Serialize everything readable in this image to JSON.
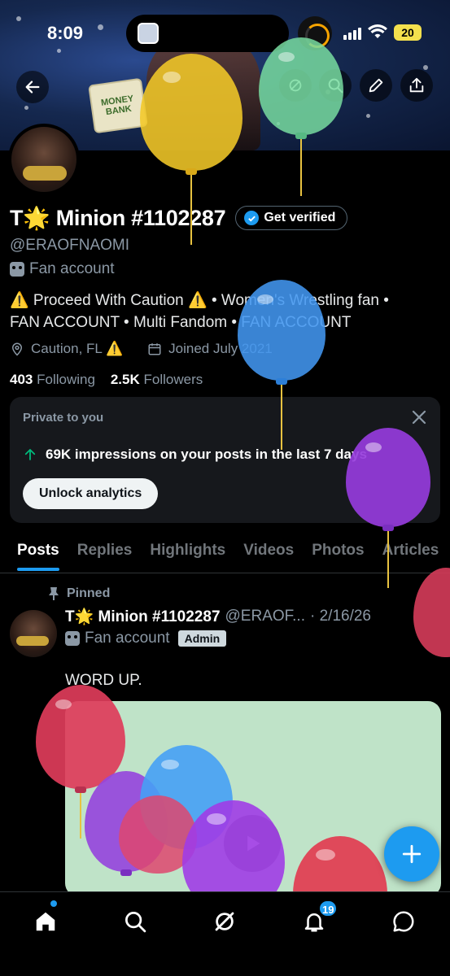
{
  "status_bar": {
    "time": "8:09",
    "battery": "20"
  },
  "banner": {
    "mitb_text": "MONEY\nBANK"
  },
  "profile": {
    "name": "T🌟 Minion #1102287",
    "get_verified_label": "Get verified",
    "handle": "@ERAOFNAOMI",
    "category": "Fan account",
    "bio_line1": "⚠️ Proceed With Caution ⚠️ • Women's Wrestling fan •",
    "bio_line2": "FAN ACCOUNT • Multi Fandom • FAN ACCOUNT",
    "location": "Caution, FL ⚠️",
    "joined": "Joined July 2021",
    "following_count": "403",
    "following_label": "Following",
    "followers_count": "2.5K",
    "followers_label": "Followers"
  },
  "analytics_card": {
    "title": "Private to you",
    "impressions_text": "69K impressions on your posts in the last 7 days",
    "unlock_label": "Unlock analytics"
  },
  "tabs": [
    "Posts",
    "Replies",
    "Highlights",
    "Videos",
    "Photos",
    "Articles"
  ],
  "post": {
    "pinned_label": "Pinned",
    "author_name": "T🌟 Minion #1102287",
    "author_handle": "@ERAOF...",
    "date": "· 2/16/26",
    "category": "Fan account",
    "admin_badge": "Admin",
    "text": "WORD UP."
  },
  "bottom_nav": {
    "notifications_badge": "19"
  },
  "colors": {
    "accent": "#1d9bf0",
    "background": "#000000",
    "secondary_text": "#8b98a5",
    "card_bg": "#16181c"
  },
  "icons": {
    "back": "arrow-left-icon",
    "grok": "grok-icon",
    "search": "search-icon",
    "edit": "pencil-icon",
    "share": "share-icon",
    "location": "location-pin-icon",
    "calendar": "calendar-icon",
    "close": "close-icon",
    "up_arrow": "arrow-up-icon",
    "pin": "pin-icon",
    "compose": "plus-icon",
    "home": "home-icon",
    "messages": "mail-icon",
    "notifications": "bell-icon"
  }
}
